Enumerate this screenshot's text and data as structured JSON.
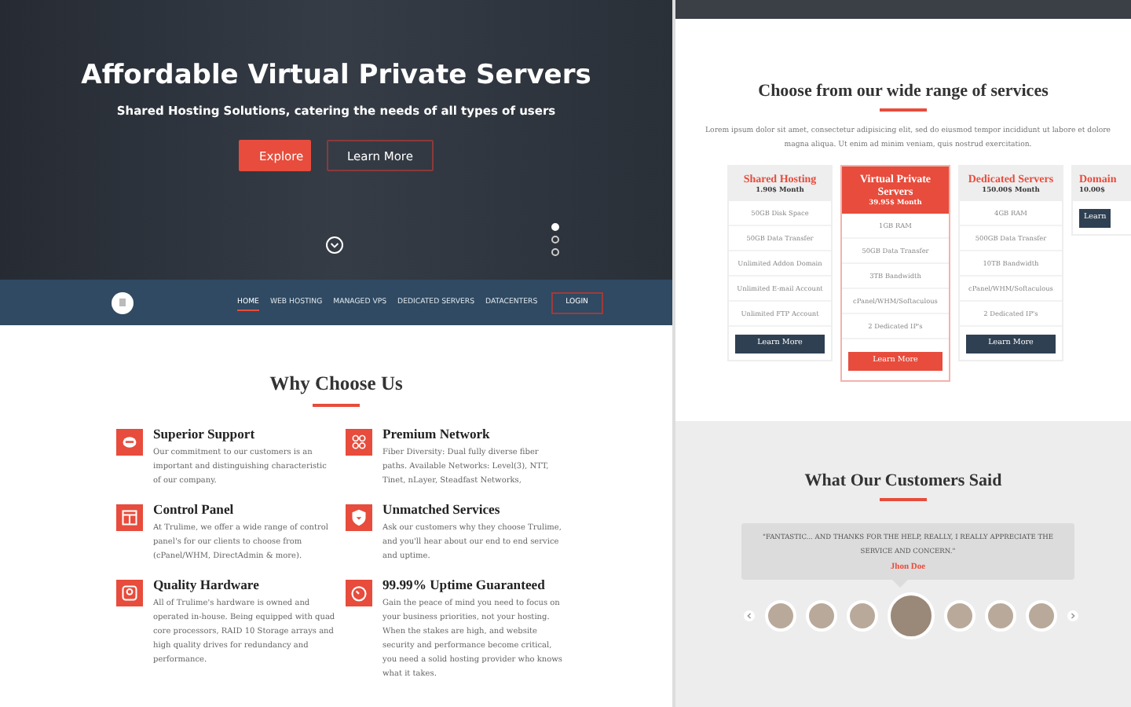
{
  "hero": {
    "title": "Affordable Virtual Private Servers",
    "subtitle": "Shared Hosting Solutions, catering the needs of all types of users",
    "buttons": [
      {
        "label": "Explore",
        "kind": "primary"
      },
      {
        "label": "Learn More",
        "kind": "outline"
      }
    ],
    "slides": [
      {
        "selected": true
      },
      {
        "selected": false
      },
      {
        "selected": false
      }
    ]
  },
  "nav": {
    "items": [
      {
        "label": "HOME",
        "selected": true
      },
      {
        "label": "WEB HOSTING",
        "selected": false
      },
      {
        "label": "MANAGED VPS",
        "selected": false
      },
      {
        "label": "DEDICATED SERVERS",
        "selected": false
      },
      {
        "label": "DATACENTERS",
        "selected": false
      }
    ],
    "login": "LOGIN"
  },
  "why": {
    "title": "Why Choose Us",
    "features": [
      {
        "title": "Superior Support",
        "text": "Our commitment to our customers is an important and distinguishing characteristic of our company."
      },
      {
        "title": "Premium Network",
        "text": "Fiber Diversity: Dual fully diverse fiber paths. Available Networks: Level(3), NTT, Tinet, nLayer, Steadfast Networks,"
      },
      {
        "title": "Control Panel",
        "text": "At Trulime, we offer a wide range of control panel's for our clients to choose from (cPanel/WHM, DirectAdmin & more)."
      },
      {
        "title": "Unmatched Services",
        "text": "Ask our customers why they choose Trulime, and you'll hear about our end to end service and uptime."
      },
      {
        "title": "Quality Hardware",
        "text": "All of Trulime's hardware is owned and operated in-house. Being equipped with quad core processors, RAID 10 Storage arrays and high quality drives for redundancy and performance."
      },
      {
        "title": "99.99% Uptime Guaranteed",
        "text": "Gain the peace of mind you need to focus on your business priorities, not your hosting. When the stakes are high, and website security and performance become critical, you need a solid hosting provider who knows what it takes."
      }
    ]
  },
  "pricing": {
    "title": "Choose from our wide range of services",
    "intro": "Lorem ipsum dolor sit amet, consectetur adipisicing elit, sed do eiusmod tempor incididunt ut labore et dolore magna aliqua. Ut enim ad minim veniam, quis nostrud exercitation.",
    "plans": [
      {
        "name": "Shared Hosting",
        "price": "1.90$ Month",
        "featured": false,
        "features": [
          "50GB Disk Space",
          "50GB Data Transfer",
          "Unlimited Addon Domain",
          "Unlimited E-mail Account",
          "Unlimited FTP Account"
        ],
        "button": "Learn More"
      },
      {
        "name": "Virtual Private Servers",
        "price": "39.95$ Month",
        "featured": true,
        "features": [
          "1GB RAM",
          "50GB Data Transfer",
          "3TB Bandwidth",
          "cPanel/WHM/Softaculous",
          "2 Dedicated IP's"
        ],
        "button": "Learn More"
      },
      {
        "name": "Dedicated Servers",
        "price": "150.00$ Month",
        "featured": false,
        "features": [
          "4GB RAM",
          "500GB Data Transfer",
          "10TB Bandwidth",
          "cPanel/WHM/Softaculous",
          "2 Dedicated IP's"
        ],
        "button": "Learn More"
      },
      {
        "name": "Domain",
        "price": "10.00$",
        "featured": false,
        "button": "Learn"
      }
    ]
  },
  "testimonials": {
    "title": "What Our Customers Said",
    "quote": "\"FANTASTIC... AND THANKS FOR THE HELP, REALLY, I REALLY APPRECIATE THE SERVICE AND CONCERN.\"",
    "author": "Jhon Doe",
    "avatars": [
      {
        "selected": false
      },
      {
        "selected": false
      },
      {
        "selected": false
      },
      {
        "selected": true
      },
      {
        "selected": false
      },
      {
        "selected": false
      },
      {
        "selected": false
      }
    ]
  }
}
